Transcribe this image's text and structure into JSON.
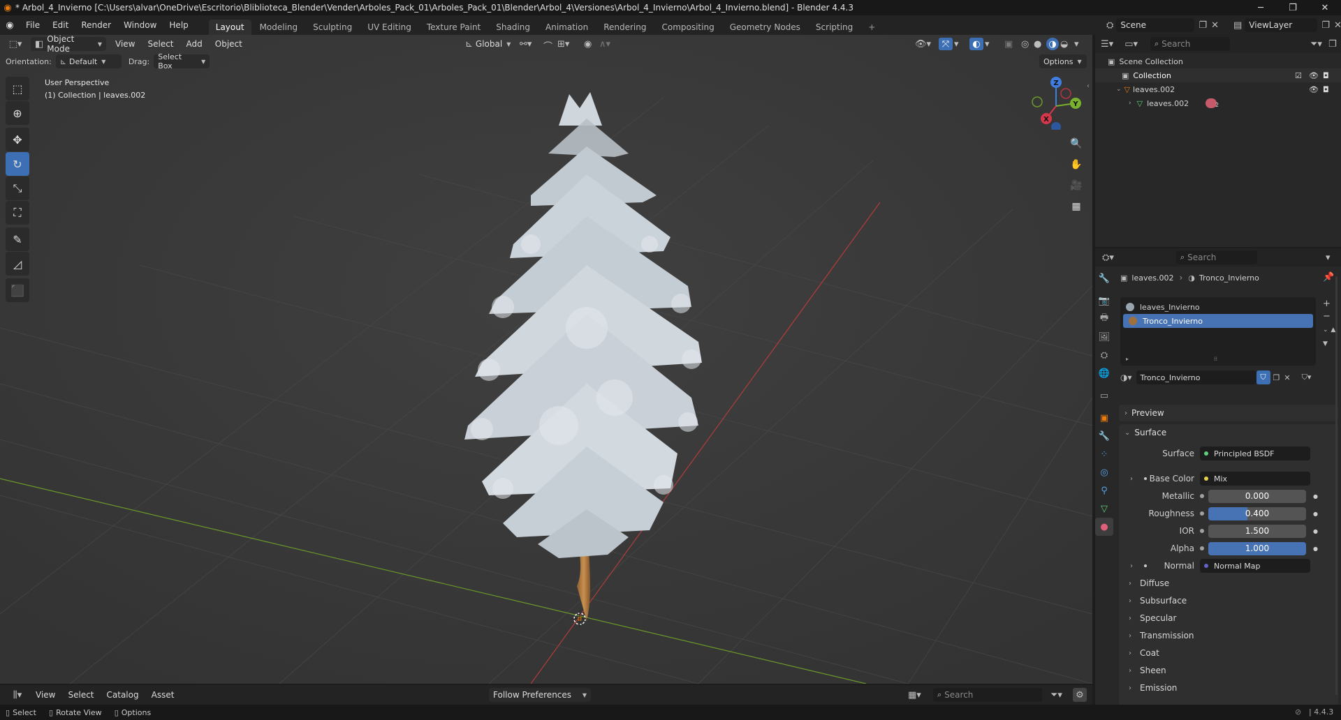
{
  "titlebar": {
    "title": "* Arbol_4_Invierno [C:\\Users\\alvar\\OneDrive\\Escritorio\\Bliblioteca_Blender\\Vender\\Arboles_Pack_01\\Arboles_Pack_01\\Blender\\Arbol_4\\Versiones\\Arbol_4_Invierno\\Arbol_4_Invierno.blend] - Blender 4.4.3",
    "minimize": "─",
    "maximize": "❐",
    "close": "✕"
  },
  "menu": {
    "items": [
      "File",
      "Edit",
      "Render",
      "Window",
      "Help"
    ],
    "workspaces": [
      "Layout",
      "Modeling",
      "Sculpting",
      "UV Editing",
      "Texture Paint",
      "Shading",
      "Animation",
      "Rendering",
      "Compositing",
      "Geometry Nodes",
      "Scripting"
    ],
    "active_workspace": "Layout",
    "add_workspace": "+",
    "scene_label": "Scene",
    "viewlayer_label": "ViewLayer"
  },
  "viewport_header": {
    "mode": "Object Mode",
    "menus": [
      "View",
      "Select",
      "Add",
      "Object"
    ],
    "transform_orientation": "Global",
    "orientation_label": "Orientation:",
    "orientation_value": "Default",
    "drag_label": "Drag:",
    "drag_value": "Select Box",
    "options_label": "Options"
  },
  "viewport": {
    "perspective": "User Perspective",
    "collection_info": "(1) Collection | leaves.002",
    "gizmo_axes": [
      "X",
      "Y",
      "Z"
    ],
    "colors": {
      "bg": "#3b3b3b",
      "grid": "#454545",
      "x_axis": "#b43c3c",
      "y_axis": "#6b9a2a",
      "accent": "#3c6fb4"
    }
  },
  "tools": [
    {
      "name": "select-box",
      "glyph": "⬚"
    },
    {
      "name": "cursor",
      "glyph": "⊕"
    },
    {
      "name": "move",
      "glyph": "✥"
    },
    {
      "name": "rotate",
      "glyph": "↻"
    },
    {
      "name": "scale",
      "glyph": "⤡"
    },
    {
      "name": "transform",
      "glyph": "⛶"
    },
    {
      "name": "annotate",
      "glyph": "✎"
    },
    {
      "name": "measure",
      "glyph": "📐"
    },
    {
      "name": "add-cube",
      "glyph": "⬛"
    }
  ],
  "outliner": {
    "search_placeholder": "Search",
    "items": [
      {
        "label": "Scene Collection",
        "indent": 0
      },
      {
        "label": "Collection",
        "indent": 1
      },
      {
        "label": "leaves.002",
        "indent": 1
      },
      {
        "label": "leaves.002",
        "indent": 2
      }
    ],
    "user_count": "2"
  },
  "properties": {
    "search_placeholder": "Search",
    "breadcrumb_object": "leaves.002",
    "breadcrumb_material": "Tronco_Invierno",
    "slots": [
      "leaves_Invierno",
      "Tronco_Invierno"
    ],
    "selected_slot": "Tronco_Invierno",
    "material_name": "Tronco_Invierno",
    "panels": {
      "preview": "Preview",
      "surface": "Surface"
    },
    "surface": {
      "label": "Surface",
      "value": "Principled BSDF"
    },
    "base_color": {
      "label": "Base Color",
      "value": "Mix"
    },
    "metallic": {
      "label": "Metallic",
      "value": "0.000",
      "fill": 0.0
    },
    "roughness": {
      "label": "Roughness",
      "value": "0.400",
      "fill": 0.4
    },
    "ior": {
      "label": "IOR",
      "value": "1.500",
      "fill": 0.0
    },
    "alpha": {
      "label": "Alpha",
      "value": "1.000",
      "fill": 1.0
    },
    "normal": {
      "label": "Normal",
      "value": "Normal Map"
    },
    "subpanels": [
      "Diffuse",
      "Subsurface",
      "Specular",
      "Transmission",
      "Coat",
      "Sheen",
      "Emission"
    ]
  },
  "asset_bar": {
    "menus": [
      "View",
      "Select",
      "Catalog",
      "Asset"
    ],
    "preferences": "Follow Preferences",
    "search_placeholder": "Search"
  },
  "statusbar": {
    "items": [
      "Select",
      "Rotate View",
      "Options"
    ],
    "version": "4.4.3"
  }
}
